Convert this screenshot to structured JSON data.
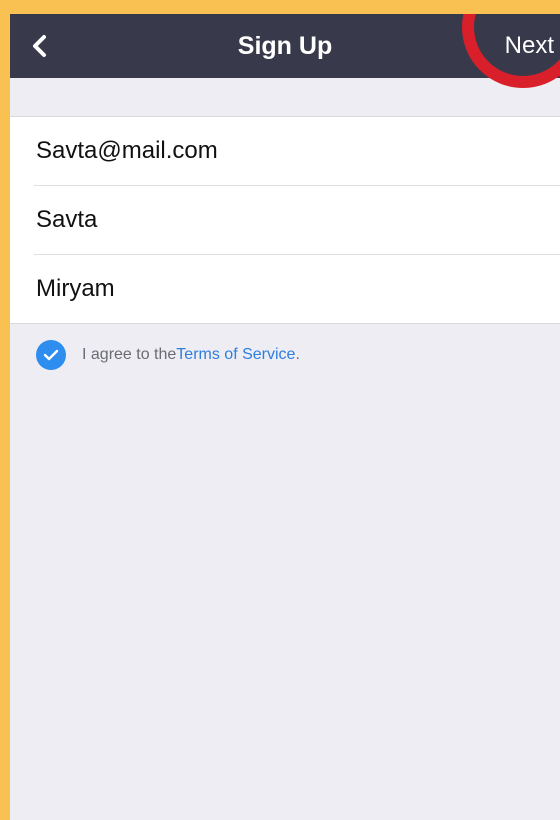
{
  "navbar": {
    "title": "Sign Up",
    "next_label": "Next",
    "back_icon": "chevron-left-icon"
  },
  "form": {
    "email_value": "Savta@mail.com",
    "first_name_value": "Savta",
    "last_name_value": "Miryam"
  },
  "terms": {
    "checked": true,
    "prefix": "I agree to the ",
    "link_label": "Terms of Service",
    "suffix": "."
  },
  "colors": {
    "border_background": "#F9C152",
    "navbar": "#383A4B",
    "page_background": "#EDEDF3",
    "accent_blue": "#2E8EF0",
    "highlight_ring": "#D9202A"
  }
}
